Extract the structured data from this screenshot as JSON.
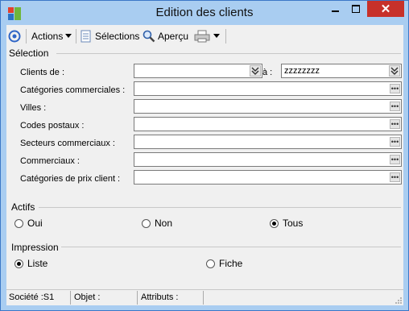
{
  "window": {
    "title": "Edition des clients"
  },
  "toolbar": {
    "actions_label": "Actions",
    "selections_label": "Sélections",
    "apercu_label": "Aperçu"
  },
  "selection": {
    "title": "Sélection",
    "clients_de_label": "Clients de :",
    "a_label": "à :",
    "clients_to_value": "zzzzzzzz",
    "categories_label": "Catégories commerciales :",
    "villes_label": "Villes :",
    "codes_postaux_label": "Codes postaux :",
    "secteurs_label": "Secteurs commerciaux :",
    "commerciaux_label": "Commerciaux :",
    "categories_prix_label": "Catégories de prix client :"
  },
  "actifs": {
    "title": "Actifs",
    "options": [
      "Oui",
      "Non",
      "Tous"
    ],
    "selected": "Tous"
  },
  "impression": {
    "title": "Impression",
    "options": [
      "Liste",
      "Fiche"
    ],
    "selected": "Liste"
  },
  "status": {
    "societe": "Société :S1",
    "objet": "Objet :",
    "attributs": "Attributs :"
  },
  "colors": {
    "frame": "#a9cdf1",
    "close_button": "#c7312a",
    "body": "#f0f0f0"
  }
}
